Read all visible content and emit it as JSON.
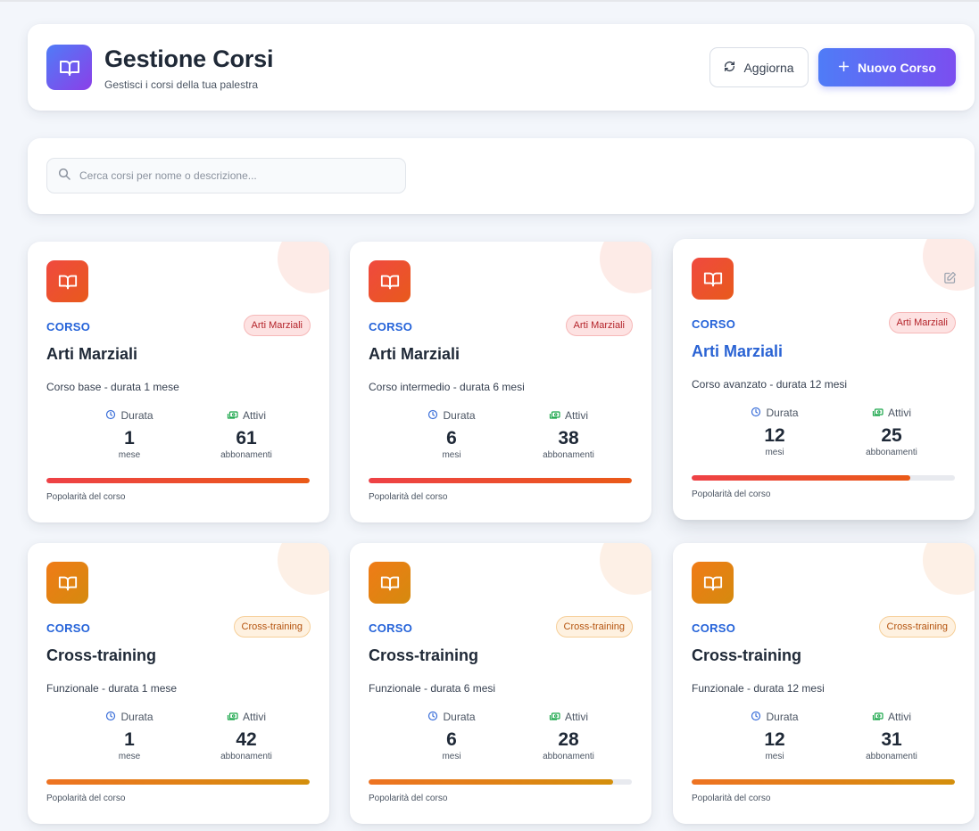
{
  "header": {
    "title": "Gestione Corsi",
    "subtitle": "Gestisci i corsi della tua palestra",
    "refresh_label": "Aggiorna",
    "new_course_label": "Nuovo Corso",
    "logo_icon": "book-open-icon"
  },
  "search": {
    "placeholder": "Cerca corsi per nome o descrizione...",
    "value": ""
  },
  "colors": {
    "accent_blue": "#4f7cf7",
    "accent_purple": "#8b3fe8",
    "red_category": "#f0493f",
    "orange_category": "#f07b17",
    "type_label": "#2563d9"
  },
  "courses": [
    {
      "type": "CORSO",
      "tag": "Arti Marziali",
      "name": "Arti Marziali",
      "description": "Corso base - durata 1 mese",
      "duration_label": "Durata",
      "duration_value": "1",
      "duration_unit": "mese",
      "active_label": "Attivi",
      "active_value": "61",
      "active_unit": "abbonamenti",
      "popularity_label": "Popolarità del corso",
      "popularity": 1.0
    },
    {
      "type": "CORSO",
      "tag": "Arti Marziali",
      "name": "Arti Marziali",
      "description": "Corso intermedio - durata 6 mesi",
      "duration_label": "Durata",
      "duration_value": "6",
      "duration_unit": "mesi",
      "active_label": "Attivi",
      "active_value": "38",
      "active_unit": "abbonamenti",
      "popularity_label": "Popolarità del corso",
      "popularity": 1.0
    },
    {
      "type": "CORSO",
      "tag": "Arti Marziali",
      "name": "Arti Marziali",
      "description": "Corso avanzato - durata 12 mesi",
      "duration_label": "Durata",
      "duration_value": "12",
      "duration_unit": "mesi",
      "active_label": "Attivi",
      "active_value": "25",
      "active_unit": "abbonamenti",
      "popularity_label": "Popolarità del corso",
      "popularity": 0.83
    },
    {
      "type": "CORSO",
      "tag": "Cross-training",
      "name": "Cross-training",
      "description": "Funzionale - durata 1 mese",
      "duration_label": "Durata",
      "duration_value": "1",
      "duration_unit": "mese",
      "active_label": "Attivi",
      "active_value": "42",
      "active_unit": "abbonamenti",
      "popularity_label": "Popolarità del corso",
      "popularity": 1.0
    },
    {
      "type": "CORSO",
      "tag": "Cross-training",
      "name": "Cross-training",
      "description": "Funzionale - durata 6 mesi",
      "duration_label": "Durata",
      "duration_value": "6",
      "duration_unit": "mesi",
      "active_label": "Attivi",
      "active_value": "28",
      "active_unit": "abbonamenti",
      "popularity_label": "Popolarità del corso",
      "popularity": 0.93
    },
    {
      "type": "CORSO",
      "tag": "Cross-training",
      "name": "Cross-training",
      "description": "Funzionale - durata 12 mesi",
      "duration_label": "Durata",
      "duration_value": "12",
      "duration_unit": "mesi",
      "active_label": "Attivi",
      "active_value": "31",
      "active_unit": "abbonamenti",
      "popularity_label": "Popolarità del corso",
      "popularity": 1.0
    }
  ]
}
